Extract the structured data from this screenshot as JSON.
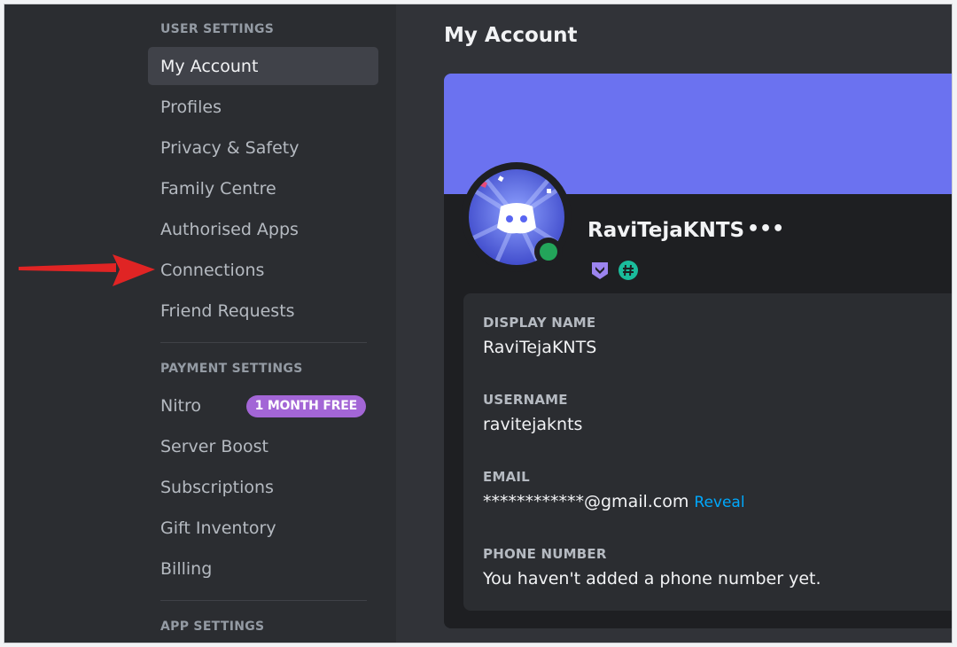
{
  "sidebar": {
    "user_settings_header": "USER SETTINGS",
    "payment_settings_header": "PAYMENT SETTINGS",
    "app_settings_header": "APP SETTINGS",
    "user_items": [
      {
        "label": "My Account",
        "selected": true
      },
      {
        "label": "Profiles"
      },
      {
        "label": "Privacy & Safety"
      },
      {
        "label": "Family Centre"
      },
      {
        "label": "Authorised Apps"
      },
      {
        "label": "Connections"
      },
      {
        "label": "Friend Requests"
      }
    ],
    "payment_items": [
      {
        "label": "Nitro",
        "badge": "1 MONTH FREE"
      },
      {
        "label": "Server Boost"
      },
      {
        "label": "Subscriptions"
      },
      {
        "label": "Gift Inventory"
      },
      {
        "label": "Billing"
      }
    ],
    "annotation": {
      "points_to": "Connections",
      "color": "#e02424"
    }
  },
  "main": {
    "title": "My Account",
    "profile": {
      "username": "RaviTejaKNTS",
      "more_label": "•••",
      "status": "online",
      "badges": [
        "hypesquad-icon",
        "hashtag-icon"
      ]
    },
    "fields": {
      "display_name_label": "DISPLAY NAME",
      "display_name_value": "RaviTejaKNTS",
      "username_label": "USERNAME",
      "username_value": "ravitejaknts",
      "email_label": "EMAIL",
      "email_value": "************@gmail.com",
      "email_reveal": "Reveal",
      "phone_label": "PHONE NUMBER",
      "phone_value": "You haven't added a phone number yet."
    }
  },
  "colors": {
    "banner": "#6b72f0",
    "accent_link": "#00a8fc",
    "status_online": "#23a55a",
    "nitro_badge": "#a366d6"
  }
}
